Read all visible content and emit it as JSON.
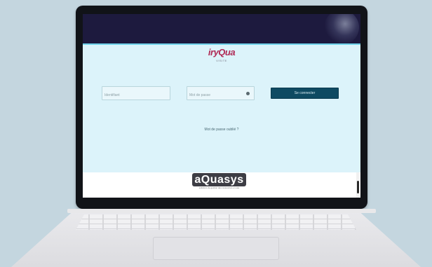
{
  "header": {
    "logo_text": "iryQua",
    "logo_subtext": "VISITE"
  },
  "login": {
    "username_placeholder": "Identifiant",
    "password_placeholder": "Mot de passe",
    "submit_label": "Se connecter",
    "forgot_password_label": "Mot de passe oublié ?"
  },
  "footer": {
    "logo_text": "aQuasys",
    "tagline": "solutions de gestion des ressources en eau"
  },
  "colors": {
    "banner": "#1d1a3e",
    "panel": "#dcf3fa",
    "button": "#0f4a62",
    "logo_accent": "#b02a55"
  },
  "icons": {
    "password_toggle": "eye-icon"
  }
}
